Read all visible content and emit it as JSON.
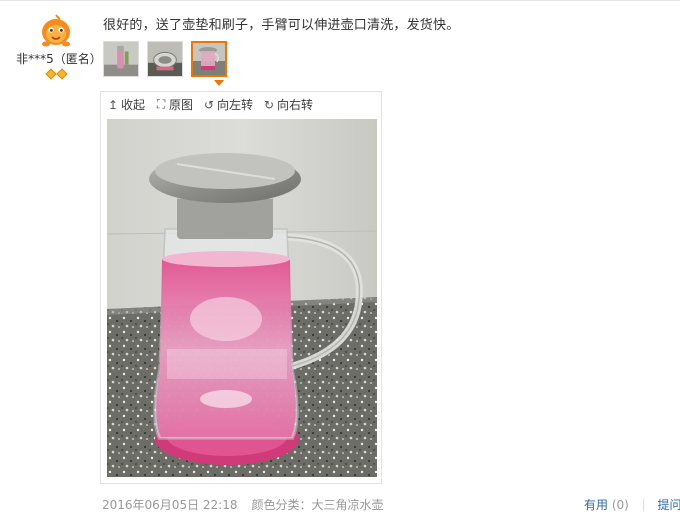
{
  "user": {
    "name": "非***5（匿名）",
    "avatar_icon": "orange-mascot-icon",
    "rank_icon": "diamond-icon",
    "rank_count": 2
  },
  "review": {
    "text": "很好的，送了壶垫和刷子，手臂可以伸进壶口清洗，发货快。",
    "thumbnails": [
      {
        "name": "thumbnail-1",
        "active": false
      },
      {
        "name": "thumbnail-2",
        "active": false
      },
      {
        "name": "thumbnail-3",
        "active": true
      }
    ]
  },
  "viewer": {
    "toolbar": {
      "collapse": {
        "label": "收起",
        "icon": "arrow-up-icon"
      },
      "original": {
        "label": "原图",
        "icon": "expand-icon"
      },
      "rotate_left": {
        "label": "向左转",
        "icon": "rotate-left-icon"
      },
      "rotate_right": {
        "label": "向右转",
        "icon": "rotate-right-icon"
      }
    }
  },
  "meta": {
    "date": "2016年06月05日 22:18",
    "variant": "颜色分类：大三角凉水壶"
  },
  "actions": {
    "useful_label": "有用",
    "useful_count": "(0)",
    "ask_label": "提问"
  },
  "colors": {
    "accent_orange": "#ee7600",
    "link_blue": "#2e6ca5",
    "meta_gray": "#999999"
  }
}
